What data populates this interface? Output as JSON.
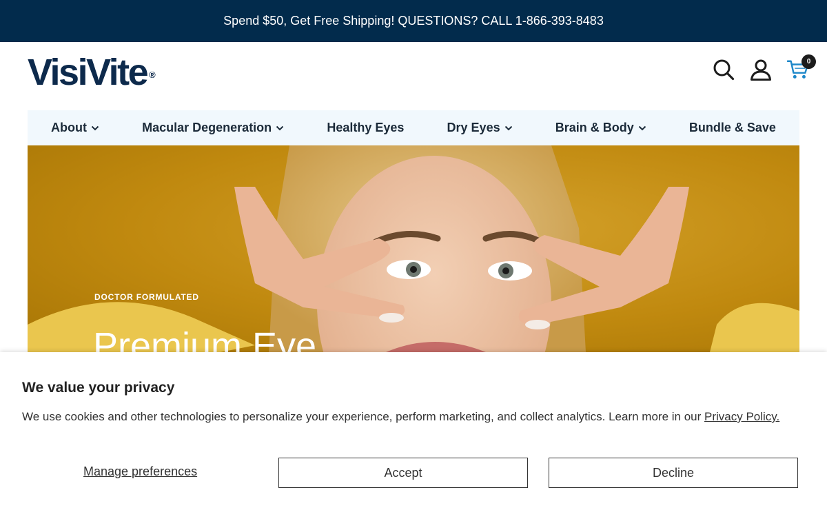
{
  "promo": {
    "text": "Spend $50, Get Free Shipping! QUESTIONS? CALL 1-866-393-8483"
  },
  "header": {
    "logo_text": "VisiVite",
    "logo_mark": "®",
    "cart_count": "0",
    "icons": [
      "search-icon",
      "account-icon",
      "cart-icon"
    ]
  },
  "nav": {
    "items": [
      {
        "label": "About",
        "has_dropdown": true
      },
      {
        "label": "Macular Degeneration",
        "has_dropdown": true
      },
      {
        "label": "Healthy Eyes",
        "has_dropdown": false
      },
      {
        "label": "Dry Eyes",
        "has_dropdown": true
      },
      {
        "label": "Brain & Body",
        "has_dropdown": true
      },
      {
        "label": "Bundle & Save",
        "has_dropdown": false
      }
    ]
  },
  "hero": {
    "eyebrow": "DOCTOR FORMULATED",
    "title": "Premium Eye",
    "background_color": "#c0890f"
  },
  "cookie": {
    "title": "We value your privacy",
    "text": "We use cookies and other technologies to personalize your experience, perform marketing, and collect analytics. Learn more in our ",
    "privacy_link": "Privacy Policy.",
    "manage_label": "Manage preferences",
    "accept_label": "Accept",
    "decline_label": "Decline"
  },
  "colors": {
    "promo_bg": "#022b4c",
    "nav_bg": "#f1f8fd",
    "logo": "#0d2a4c",
    "cart_accent": "#1e88c9"
  }
}
